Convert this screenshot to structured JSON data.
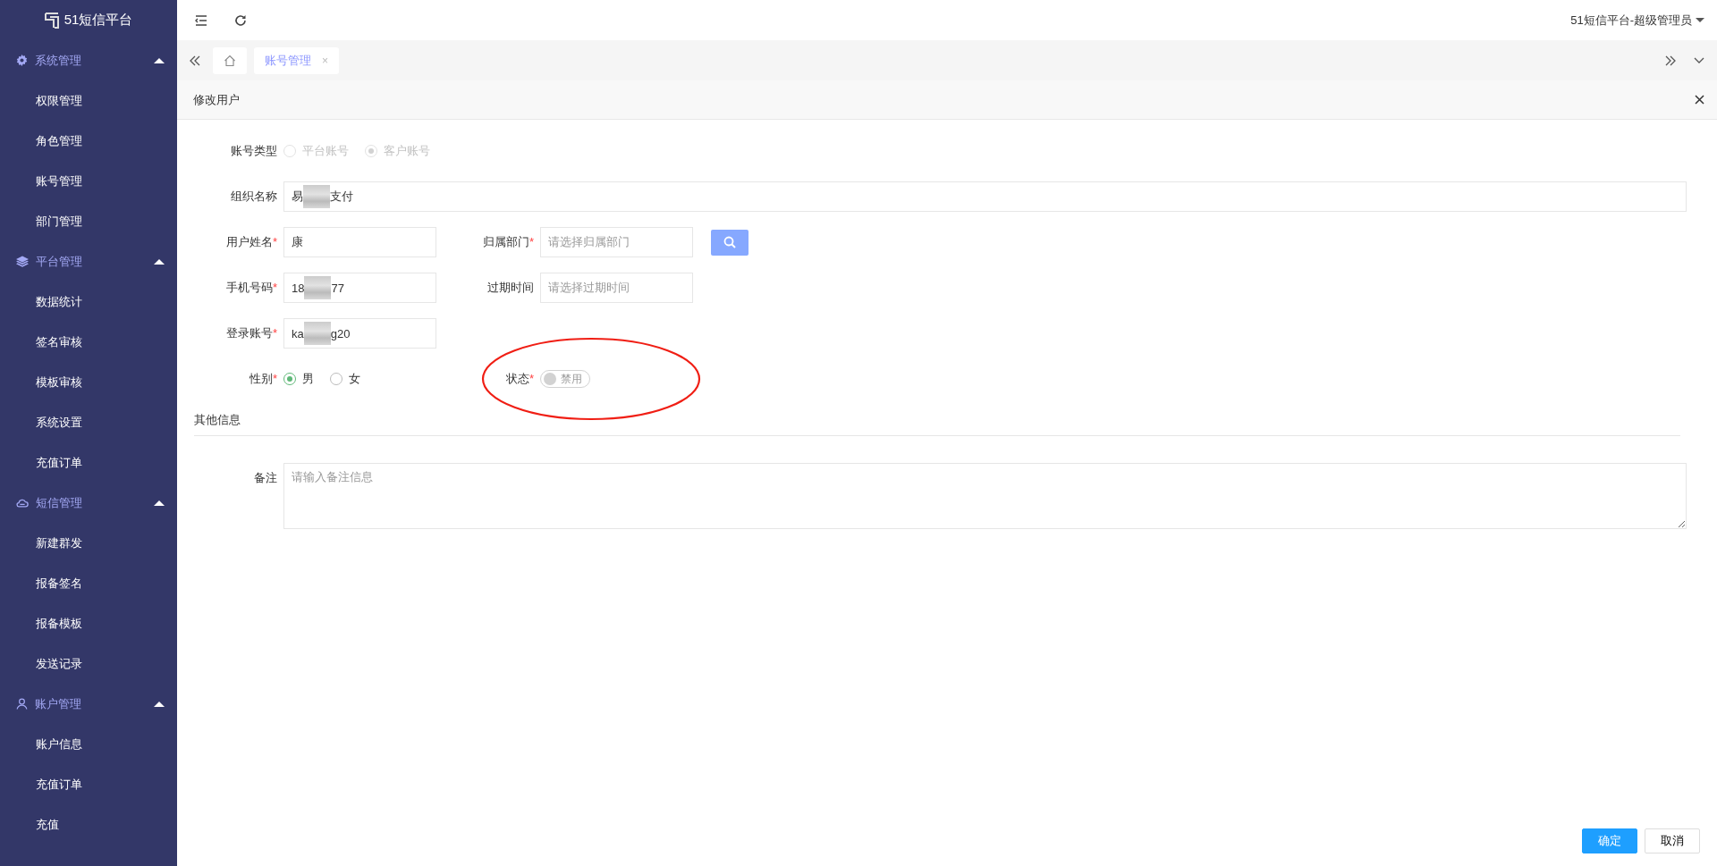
{
  "sidebar": {
    "logo": "51短信平台",
    "groups": [
      {
        "title": "系统管理",
        "expanded": true,
        "items": [
          {
            "label": "权限管理"
          },
          {
            "label": "角色管理"
          },
          {
            "label": "账号管理"
          },
          {
            "label": "部门管理"
          }
        ]
      },
      {
        "title": "平台管理",
        "expanded": true,
        "items": [
          {
            "label": "数据统计"
          },
          {
            "label": "签名审核"
          },
          {
            "label": "模板审核"
          },
          {
            "label": "系统设置"
          },
          {
            "label": "充值订单"
          }
        ]
      },
      {
        "title": "短信管理",
        "expanded": true,
        "items": [
          {
            "label": "新建群发"
          },
          {
            "label": "报备签名"
          },
          {
            "label": "报备模板"
          },
          {
            "label": "发送记录"
          }
        ]
      },
      {
        "title": "账户管理",
        "expanded": true,
        "items": [
          {
            "label": "账户信息"
          },
          {
            "label": "充值订单"
          },
          {
            "label": "充值"
          }
        ]
      }
    ]
  },
  "header": {
    "user": "51短信平台-超级管理员"
  },
  "tabs": [
    {
      "kind": "home",
      "selected": false
    },
    {
      "kind": "page",
      "label": "账号管理",
      "close_mark": "×",
      "selected": true
    }
  ],
  "panel": {
    "title": "修改用户"
  },
  "form": {
    "rows": [
      [
        {
          "kind": "radio",
          "label": "账号类型",
          "disabled": true,
          "options": [
            {
              "label": "平台账号",
              "selected": false
            },
            {
              "label": "客户账号",
              "selected": true
            }
          ]
        }
      ],
      [
        {
          "kind": "wide",
          "label": "组织名称",
          "value_parts": [
            "易",
            "支付"
          ]
        }
      ],
      [
        {
          "kind": "text",
          "label": "用户姓名",
          "required_mark": "*",
          "value_parts": [
            "康"
          ]
        },
        {
          "kind": "select",
          "label": "归属部门",
          "required_mark": "*",
          "placeholder": "请选择归属部门"
        }
      ],
      [
        {
          "kind": "text",
          "label": "手机号码",
          "required_mark": "*",
          "value_parts": [
            "18",
            "77"
          ]
        },
        {
          "kind": "select_plain",
          "label": "过期时间",
          "placeholder": "请选择过期时间"
        }
      ],
      [
        {
          "kind": "text",
          "label": "登录账号",
          "required_mark": "*",
          "value_parts": [
            "ka",
            "g20"
          ]
        }
      ],
      [
        {
          "kind": "radio",
          "label": "性别",
          "required_mark": "*",
          "options": [
            {
              "label": "男",
              "selected": true
            },
            {
              "label": "女",
              "selected": false
            }
          ]
        },
        {
          "kind": "switch",
          "label": "状态",
          "required_mark": "*",
          "on": false,
          "disabled": true,
          "text": "禁用"
        }
      ]
    ],
    "section": "其他信息",
    "remark": {
      "label": "备注",
      "placeholder": "请输入备注信息"
    }
  },
  "buttons": [
    {
      "label": "确定",
      "kind": "primary"
    },
    {
      "label": "取消",
      "kind": "default"
    }
  ]
}
